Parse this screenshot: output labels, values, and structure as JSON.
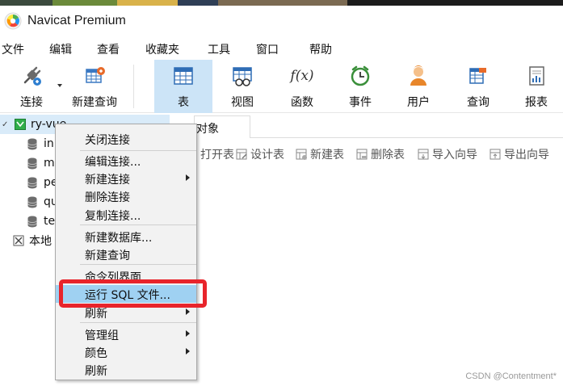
{
  "title_bar": {
    "app_title": "Navicat Premium"
  },
  "menu_bar": {
    "items": [
      "文件",
      "编辑",
      "查看",
      "收藏夹",
      "工具",
      "窗口",
      "帮助"
    ]
  },
  "toolbar": {
    "buttons": [
      {
        "label": "连接",
        "icon": "plug-icon"
      },
      {
        "label": "新建查询",
        "icon": "new-query-icon"
      },
      {
        "label": "表",
        "icon": "table-icon",
        "active": true
      },
      {
        "label": "视图",
        "icon": "view-icon"
      },
      {
        "label": "函数",
        "icon": "function-icon",
        "glyph": "f(x)"
      },
      {
        "label": "事件",
        "icon": "clock-icon"
      },
      {
        "label": "用户",
        "icon": "user-icon"
      },
      {
        "label": "查询",
        "icon": "query-icon"
      },
      {
        "label": "报表",
        "icon": "report-icon"
      }
    ]
  },
  "nav_tree": {
    "connection": {
      "name": "ry-vue",
      "expanded_glyph": "✓"
    },
    "databases": [
      "in",
      "m",
      "pe",
      "qu",
      "te"
    ],
    "local_group": "本地"
  },
  "content": {
    "tab_label": "对象",
    "object_toolbar": [
      {
        "label": "打开表",
        "icon": "open-table-icon"
      },
      {
        "label": "设计表",
        "icon": "design-table-icon"
      },
      {
        "label": "新建表",
        "icon": "new-table-icon"
      },
      {
        "label": "删除表",
        "icon": "delete-table-icon"
      },
      {
        "label": "导入向导",
        "icon": "import-wizard-icon"
      },
      {
        "label": "导出向导",
        "icon": "export-wizard-icon"
      }
    ]
  },
  "context_menu": {
    "items": [
      {
        "label": "关闭连接"
      },
      {
        "label": "编辑连接..."
      },
      {
        "label": "新建连接",
        "submenu": true
      },
      {
        "label": "删除连接"
      },
      {
        "label": "复制连接..."
      },
      {
        "label": "新建数据库..."
      },
      {
        "label": "新建查询"
      },
      {
        "label": "命令列界面"
      },
      {
        "label": "运行 SQL 文件...",
        "highlighted": true
      },
      {
        "label": "刷新",
        "submenu": true
      },
      {
        "label": "管理组",
        "submenu": true
      },
      {
        "label": "颜色",
        "submenu": true
      },
      {
        "label": "刷新"
      }
    ]
  },
  "colors": {
    "active_tool_bg": "#cce4f7",
    "highlight_bg": "#9fd1f2",
    "annotation_red": "#e8242b",
    "tree_selected_bg": "#d9ebf9"
  },
  "watermark": "CSDN @Contentment*"
}
